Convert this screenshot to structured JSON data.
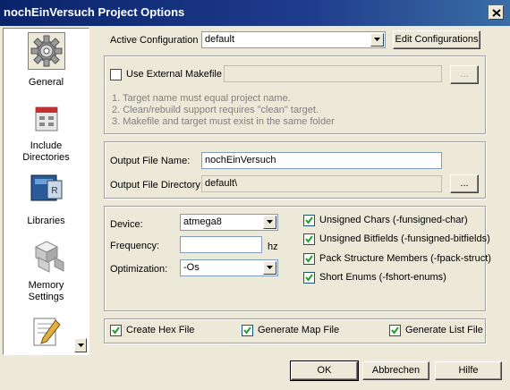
{
  "window": {
    "title": "nochEinVersuch Project Options"
  },
  "sidebar": {
    "items": [
      {
        "label": "General",
        "icon": "gear-icon",
        "active": true
      },
      {
        "label": "Include\nDirectories",
        "icon": "include-directories-icon"
      },
      {
        "label": "Libraries",
        "icon": "libraries-icon"
      },
      {
        "label": "Memory\nSettings",
        "icon": "memory-settings-icon"
      },
      {
        "label": "",
        "icon": "custom-options-icon"
      }
    ]
  },
  "config": {
    "active_label": "Active Configuration",
    "active_value": "default",
    "edit_button": "Edit Configurations"
  },
  "makefile": {
    "use_external_label": "Use External Makefile",
    "use_external_checked": false,
    "path_value": "",
    "browse_label": "...",
    "notes": [
      "1. Target name must equal project name.",
      "2. Clean/rebuild support requires  \"clean\" target.",
      "3. Makefile and target must exist in the same folder"
    ]
  },
  "output": {
    "file_name_label": "Output File Name:",
    "file_name_value": "nochEinVersuch",
    "directory_label": "Output File Directory:",
    "directory_value": "default\\",
    "browse_label": "..."
  },
  "device": {
    "device_label": "Device:",
    "device_value": "atmega8",
    "frequency_label": "Frequency:",
    "frequency_value": "",
    "frequency_unit": "hz",
    "optimization_label": "Optimization:",
    "optimization_value": "-Os"
  },
  "compiler_flags": [
    {
      "label": "Unsigned Chars (-funsigned-char)",
      "checked": true
    },
    {
      "label": "Unsigned Bitfields (-funsigned-bitfields)",
      "checked": true
    },
    {
      "label": "Pack Structure Members (-fpack-struct)",
      "checked": true
    },
    {
      "label": "Short Enums (-fshort-enums)",
      "checked": true
    }
  ],
  "outputs": [
    {
      "label": "Create Hex File",
      "checked": true
    },
    {
      "label": "Generate Map File",
      "checked": true
    },
    {
      "label": "Generate List File",
      "checked": true
    }
  ],
  "buttons": {
    "ok": "OK",
    "cancel": "Abbrechen",
    "help": "Hilfe"
  },
  "colors": {
    "titlebar": "#0a246a",
    "dialog": "#ece9d8"
  }
}
